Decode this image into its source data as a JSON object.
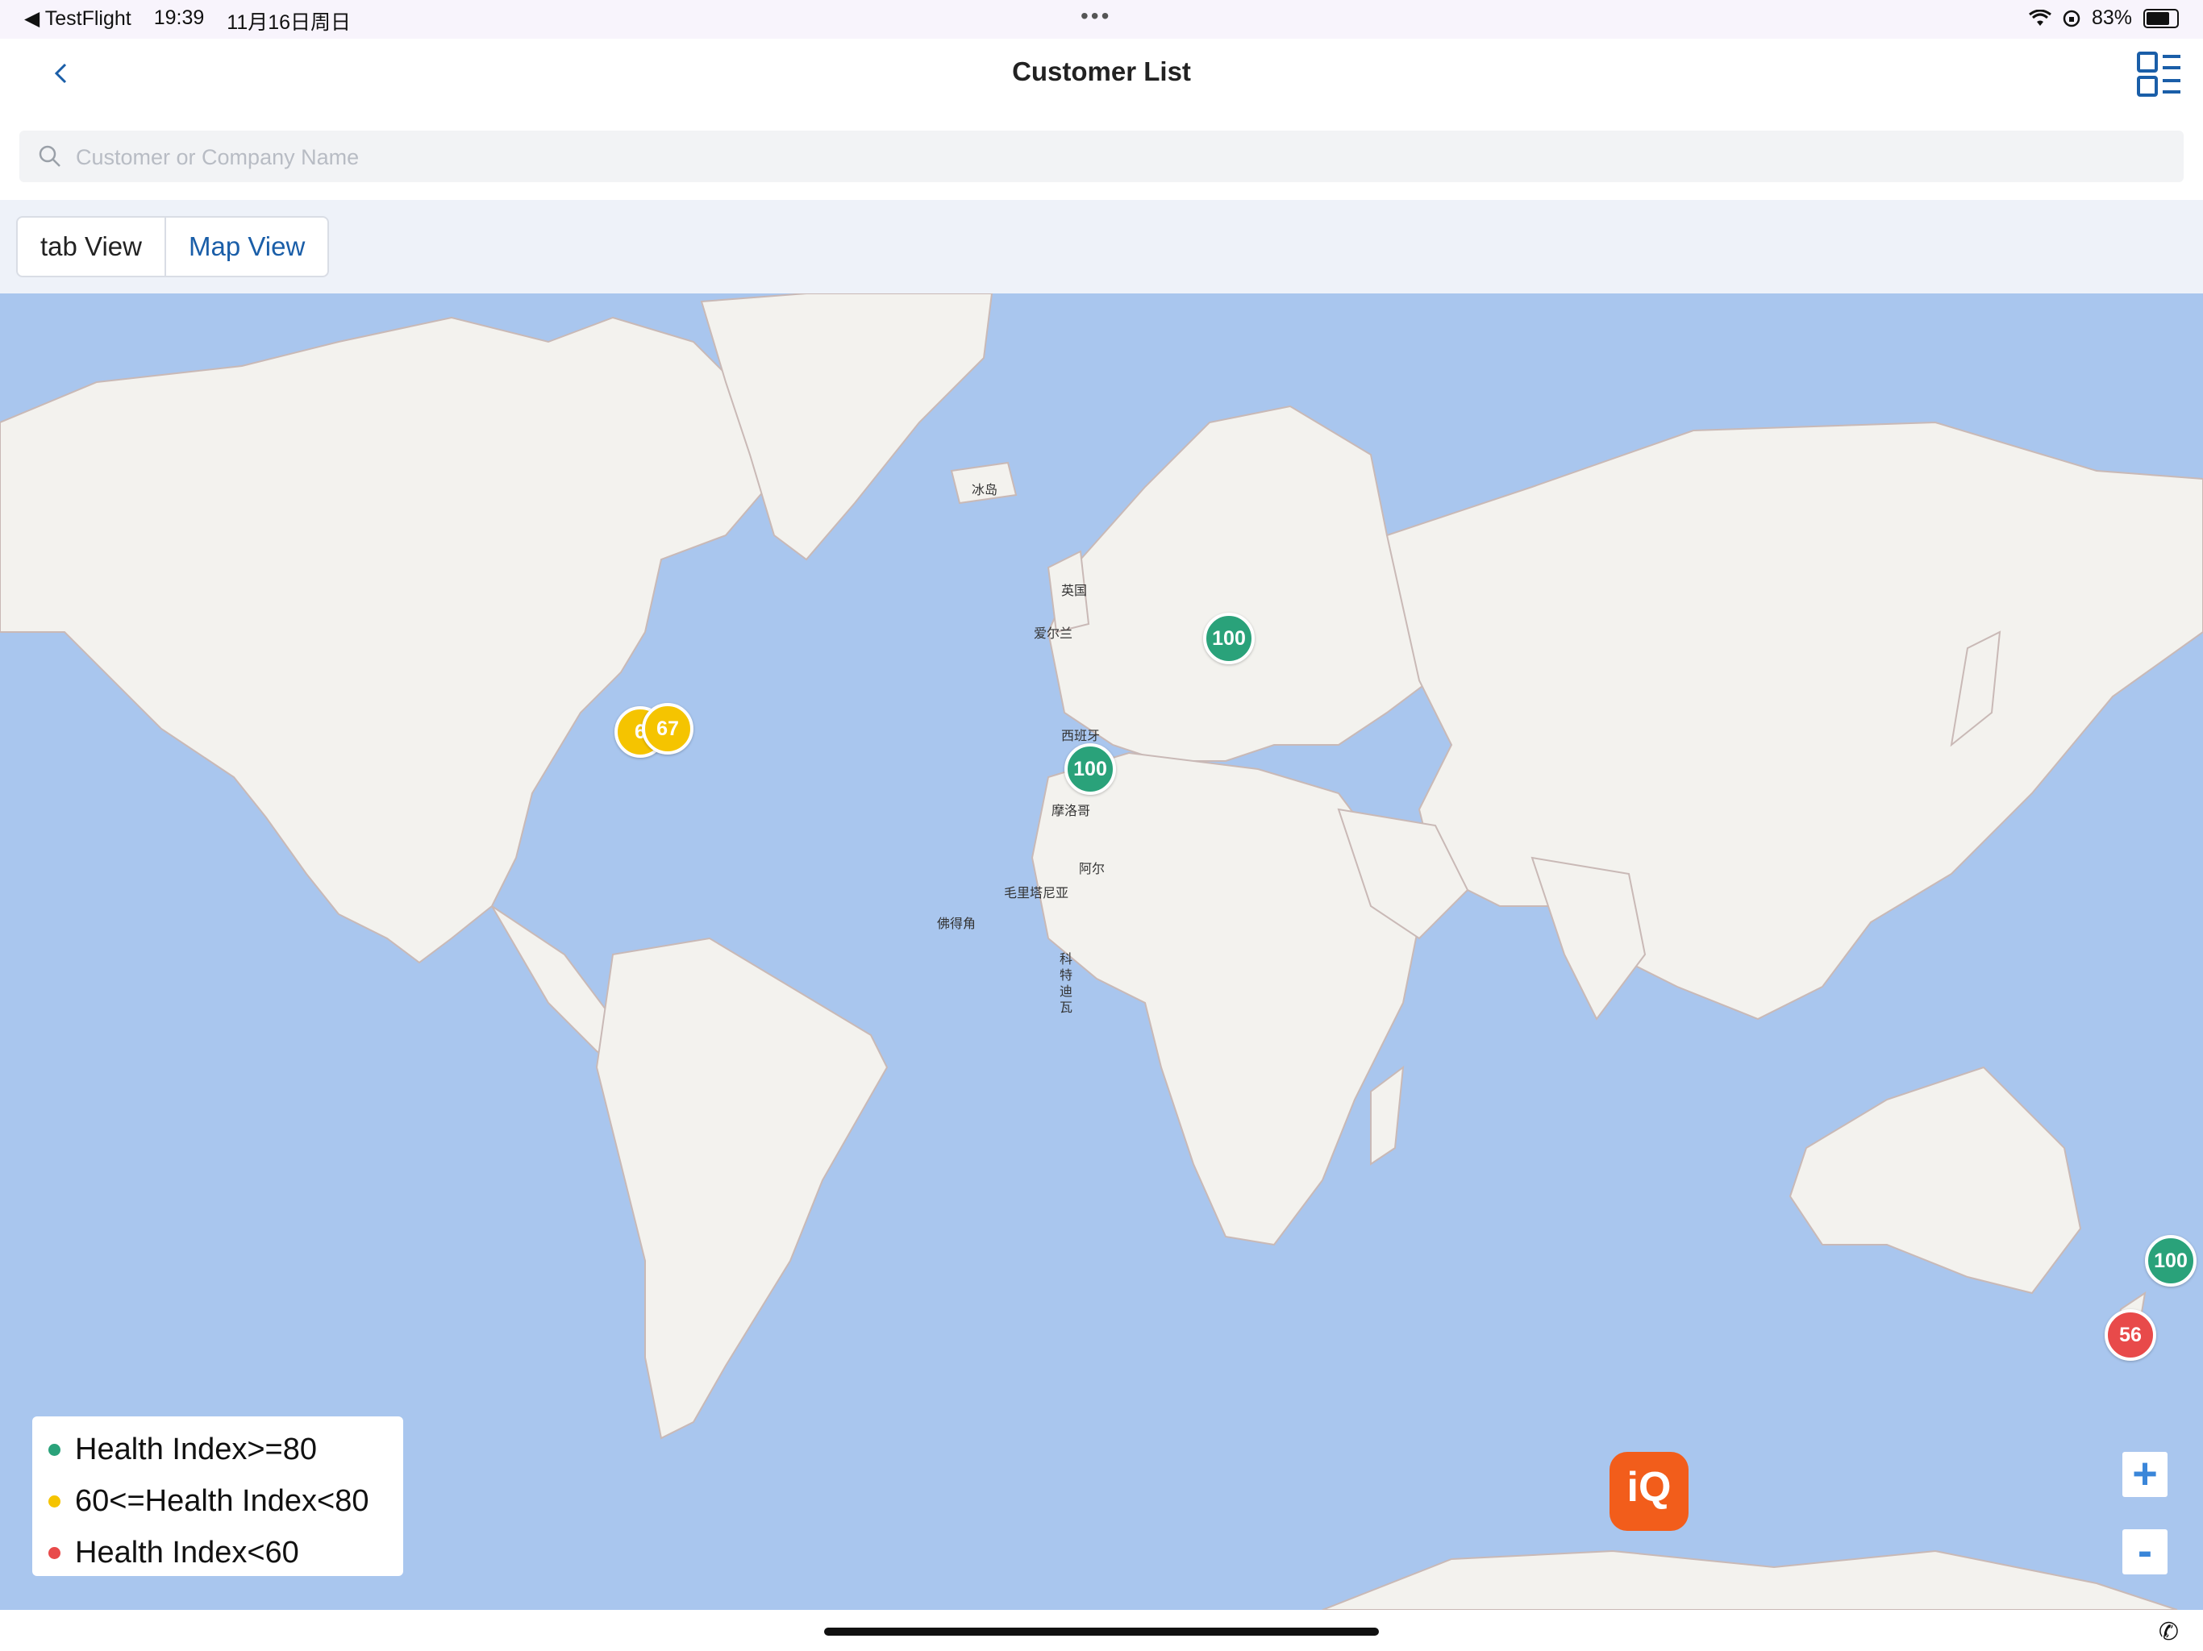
{
  "status_bar": {
    "back_app": "◀ TestFlight",
    "time": "19:39",
    "date": "11月16日周日",
    "battery": "83%",
    "battery_level": 0.83
  },
  "header": {
    "title": "Customer List"
  },
  "search": {
    "placeholder": "Customer or Company Name",
    "value": ""
  },
  "view_tabs": [
    {
      "label": "tab View",
      "active": false
    },
    {
      "label": "Map View",
      "active": true
    }
  ],
  "map": {
    "place_labels": [
      "冰岛",
      "英国",
      "爱尔兰",
      "西班牙",
      "摩洛哥",
      "阿尔",
      "毛里塔尼亚",
      "佛得角",
      "科",
      "特",
      "迪",
      "瓦"
    ],
    "markers": [
      {
        "value": "100",
        "status": "green"
      },
      {
        "value": "100",
        "status": "green"
      },
      {
        "value": "6",
        "status": "yellow"
      },
      {
        "value": "67",
        "status": "yellow"
      },
      {
        "value": "100",
        "status": "green"
      },
      {
        "value": "56",
        "status": "red"
      }
    ],
    "zoom_in": "+",
    "zoom_out": "-",
    "logo_text": "iQ"
  },
  "legend": [
    {
      "label": "Health Index>=80",
      "color": "#2aa27a"
    },
    {
      "label": "60<=Health Index<80",
      "color": "#f5c400"
    },
    {
      "label": "Health Index<60",
      "color": "#e84a4a"
    }
  ],
  "colors": {
    "accent": "#1a5ea8",
    "map_water": "#a9c6ee",
    "map_land": "#f3f2ee",
    "logo": "#f25d1b"
  }
}
